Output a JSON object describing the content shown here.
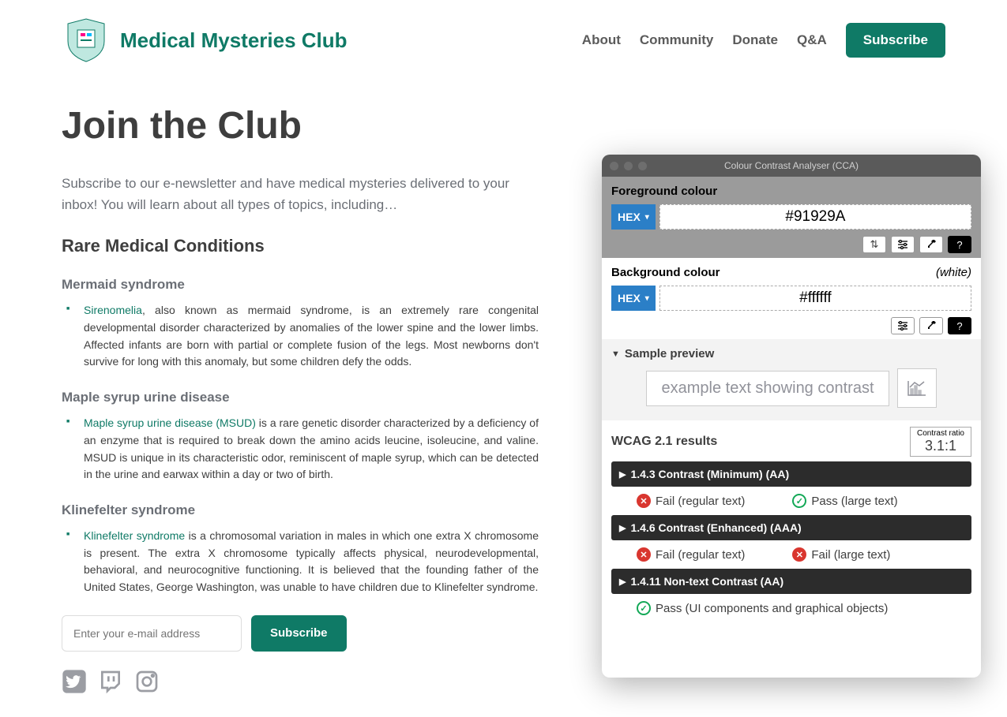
{
  "header": {
    "brand": "Medical Mysteries Club",
    "nav": [
      "About",
      "Community",
      "Donate",
      "Q&A"
    ],
    "subscribe": "Subscribe"
  },
  "page": {
    "title": "Join the Club",
    "intro": "Subscribe to our e-newsletter and have medical mysteries delivered to your inbox! You will learn about all types of topics, including…",
    "section_heading": "Rare Medical Conditions",
    "conditions": [
      {
        "name": "Mermaid syndrome",
        "link": "Sirenomelia",
        "text": ", also known as mermaid syndrome, is an extremely rare congenital developmental disorder characterized by anomalies of the lower spine and the lower limbs. Affected infants are born with partial or complete fusion of the legs. Most newborns don't survive for long with this anomaly, but some children defy the odds."
      },
      {
        "name": "Maple syrup urine disease",
        "link": "Maple syrup urine disease (MSUD)",
        "text": " is a rare genetic disorder characterized by a deficiency of an enzyme that is required to break down the amino acids leucine, isoleucine, and valine. MSUD is unique in its characteristic odor, reminiscent of maple syrup, which can be detected in the urine and earwax within a day or two of birth."
      },
      {
        "name": "Klinefelter syndrome",
        "link": "Klinefelter syndrome",
        "text": " is a chromosomal variation in males in which one extra X chromosome is present. The extra X chromosome typically affects physical, neurodevelopmental, behavioral, and neurocognitive functioning. It is believed that the founding father of the United States, George Washington, was unable to have children due to Klinefelter syndrome."
      }
    ],
    "email_placeholder": "Enter your e-mail address",
    "email_subscribe": "Subscribe"
  },
  "cca": {
    "title": "Colour Contrast Analyser (CCA)",
    "foreground_label": "Foreground colour",
    "background_label": "Background colour",
    "white_label": "(white)",
    "hex_label": "HEX",
    "fg_value": "#91929A",
    "bg_value": "#ffffff",
    "preview_label": "Sample preview",
    "preview_text": "example text showing contrast",
    "results_title": "WCAG 2.1 results",
    "ratio_label": "Contrast ratio",
    "ratio_value": "3.1:1",
    "criteria": [
      {
        "title": "1.4.3 Contrast (Minimum) (AA)",
        "items": [
          {
            "pass": false,
            "text": "Fail (regular text)"
          },
          {
            "pass": true,
            "text": "Pass (large text)"
          }
        ]
      },
      {
        "title": "1.4.6 Contrast (Enhanced) (AAA)",
        "items": [
          {
            "pass": false,
            "text": "Fail (regular text)"
          },
          {
            "pass": false,
            "text": "Fail (large text)"
          }
        ]
      },
      {
        "title": "1.4.11 Non-text Contrast (AA)",
        "items": [
          {
            "pass": true,
            "text": "Pass (UI components and graphical objects)"
          }
        ]
      }
    ]
  }
}
